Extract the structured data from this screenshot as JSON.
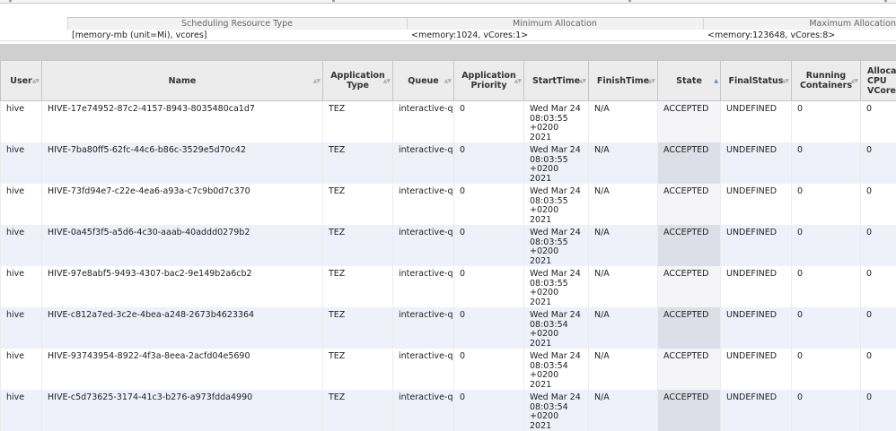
{
  "scheduler": {
    "headers": [
      "Scheduling Resource Type",
      "Minimum Allocation",
      "Maximum Allocation"
    ],
    "values": [
      "[memory-mb (unit=Mi), vcores]",
      "<memory:1024, vCores:1>",
      "<memory:123648, vCores:8>"
    ]
  },
  "apps_table": {
    "columns": [
      {
        "label": "User"
      },
      {
        "label": "Name"
      },
      {
        "label": "Application Type"
      },
      {
        "label": "Queue"
      },
      {
        "label": "Application Priority"
      },
      {
        "label": "StartTime"
      },
      {
        "label": "FinishTime"
      },
      {
        "label": "State",
        "sorted": "asc"
      },
      {
        "label": "FinalStatus"
      },
      {
        "label": "Running Containers"
      },
      {
        "label": "Allocated CPU VCores"
      }
    ],
    "rows": [
      {
        "user": "hive",
        "name": "HIVE-17e74952-87c2-4157-8943-8035480ca1d7",
        "type": "TEZ",
        "queue": "interactive-q",
        "priority": "0",
        "start": "Wed Mar 24 08:03:55 +0200 2021",
        "finish": "N/A",
        "state": "ACCEPTED",
        "final_status": "UNDEFINED",
        "running": "0",
        "vcores": "0"
      },
      {
        "user": "hive",
        "name": "HIVE-7ba80ff5-62fc-44c6-b86c-3529e5d70c42",
        "type": "TEZ",
        "queue": "interactive-q",
        "priority": "0",
        "start": "Wed Mar 24 08:03:55 +0200 2021",
        "finish": "N/A",
        "state": "ACCEPTED",
        "final_status": "UNDEFINED",
        "running": "0",
        "vcores": "0"
      },
      {
        "user": "hive",
        "name": "HIVE-73fd94e7-c22e-4ea6-a93a-c7c9b0d7c370",
        "type": "TEZ",
        "queue": "interactive-q",
        "priority": "0",
        "start": "Wed Mar 24 08:03:55 +0200 2021",
        "finish": "N/A",
        "state": "ACCEPTED",
        "final_status": "UNDEFINED",
        "running": "0",
        "vcores": "0"
      },
      {
        "user": "hive",
        "name": "HIVE-0a45f3f5-a5d6-4c30-aaab-40addd0279b2",
        "type": "TEZ",
        "queue": "interactive-q",
        "priority": "0",
        "start": "Wed Mar 24 08:03:55 +0200 2021",
        "finish": "N/A",
        "state": "ACCEPTED",
        "final_status": "UNDEFINED",
        "running": "0",
        "vcores": "0"
      },
      {
        "user": "hive",
        "name": "HIVE-97e8abf5-9493-4307-bac2-9e149b2a6cb2",
        "type": "TEZ",
        "queue": "interactive-q",
        "priority": "0",
        "start": "Wed Mar 24 08:03:55 +0200 2021",
        "finish": "N/A",
        "state": "ACCEPTED",
        "final_status": "UNDEFINED",
        "running": "0",
        "vcores": "0"
      },
      {
        "user": "hive",
        "name": "HIVE-c812a7ed-3c2e-4bea-a248-2673b4623364",
        "type": "TEZ",
        "queue": "interactive-q",
        "priority": "0",
        "start": "Wed Mar 24 08:03:54 +0200 2021",
        "finish": "N/A",
        "state": "ACCEPTED",
        "final_status": "UNDEFINED",
        "running": "0",
        "vcores": "0"
      },
      {
        "user": "hive",
        "name": "HIVE-93743954-8922-4f3a-8eea-2acfd04e5690",
        "type": "TEZ",
        "queue": "interactive-q",
        "priority": "0",
        "start": "Wed Mar 24 08:03:54 +0200 2021",
        "finish": "N/A",
        "state": "ACCEPTED",
        "final_status": "UNDEFINED",
        "running": "0",
        "vcores": "0"
      },
      {
        "user": "hive",
        "name": "HIVE-c5d73625-3174-41c3-b276-a973fdda4990",
        "type": "TEZ",
        "queue": "interactive-q",
        "priority": "0",
        "start": "Wed Mar 24 08:03:54 +0200 2021",
        "finish": "N/A",
        "state": "ACCEPTED",
        "final_status": "UNDEFINED",
        "running": "0",
        "vcores": "0"
      }
    ]
  },
  "colors": {
    "even_row": "#eef0fa",
    "sorted_column": "#dddee8",
    "header_bg": "#ececec",
    "band": "#cfcfcf"
  }
}
